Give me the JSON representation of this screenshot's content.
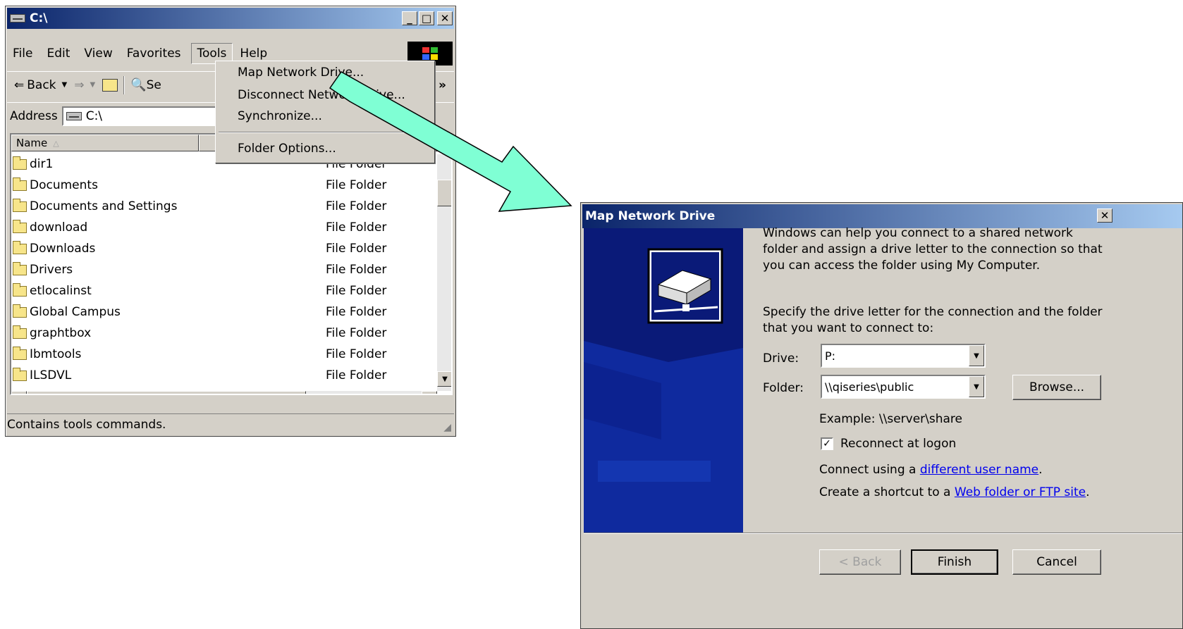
{
  "explorer": {
    "title": "C:\\",
    "menus": [
      "File",
      "Edit",
      "View",
      "Favorites",
      "Tools",
      "Help"
    ],
    "toolbar": {
      "back": "Back",
      "search_partial": "Se"
    },
    "address_label": "Address",
    "address_value": "C:\\",
    "column_name": "Name",
    "rows": [
      {
        "name": "dir1",
        "type": "File Folder"
      },
      {
        "name": "Documents",
        "type": "File Folder"
      },
      {
        "name": "Documents and Settings",
        "type": "File Folder"
      },
      {
        "name": "download",
        "type": "File Folder"
      },
      {
        "name": "Downloads",
        "type": "File Folder"
      },
      {
        "name": "Drivers",
        "type": "File Folder"
      },
      {
        "name": "etlocalinst",
        "type": "File Folder"
      },
      {
        "name": "Global Campus",
        "type": "File Folder"
      },
      {
        "name": "graphtbox",
        "type": "File Folder"
      },
      {
        "name": "Ibmtools",
        "type": "File Folder"
      },
      {
        "name": "ILSDVL",
        "type": "File Folder"
      }
    ],
    "status": "Contains tools commands.",
    "tools_menu": [
      "Map Network Drive...",
      "Disconnect Network Drive...",
      "Synchronize...",
      "Folder Options..."
    ]
  },
  "dialog": {
    "title": "Map Network Drive",
    "intro": "Windows can help you connect to a shared network folder and assign a drive letter to the connection so that you can access the folder using My Computer.",
    "specify": "Specify the drive letter for the connection and the folder that you want to connect to:",
    "drive_label": "Drive:",
    "drive_value": "P:",
    "folder_label": "Folder:",
    "folder_value": "\\\\qiseries\\public",
    "browse_label": "Browse...",
    "example": "Example: \\\\server\\share",
    "reconnect_label": "Reconnect at logon",
    "connect_prefix": "Connect using a ",
    "connect_link": "different user name",
    "shortcut_prefix": "Create a shortcut to a ",
    "shortcut_link": "Web folder or FTP site",
    "back_label": "< Back",
    "finish_label": "Finish",
    "cancel_label": "Cancel"
  },
  "colors": {
    "arrow": "#7fffd4",
    "titlebar": "#0a246a",
    "side_panel": "#0a1a78"
  }
}
